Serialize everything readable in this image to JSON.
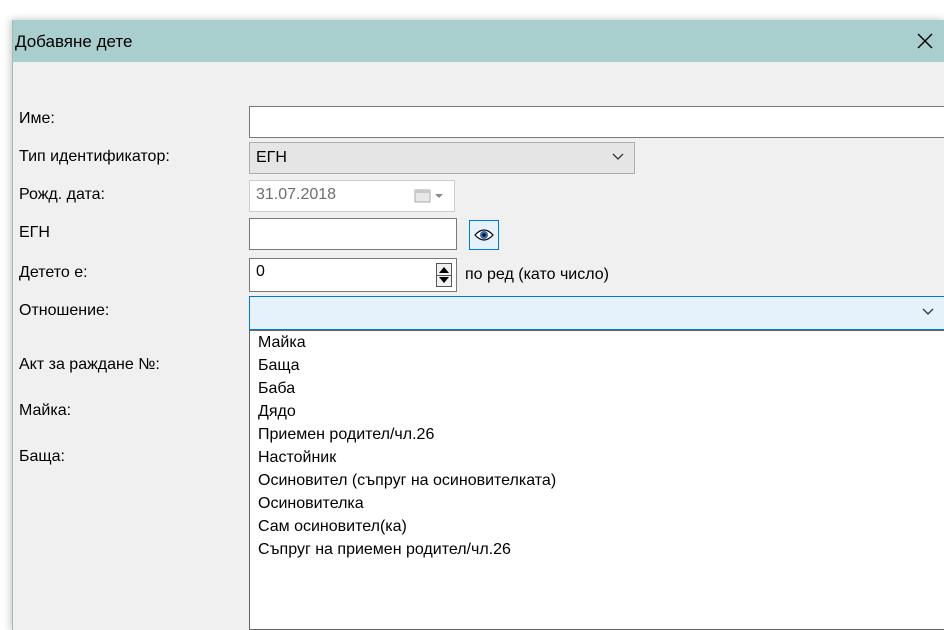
{
  "window": {
    "title": "Добавяне дете"
  },
  "form": {
    "name_label": "Име:",
    "name_value": "",
    "id_type_label": "Тип идентификатор:",
    "id_type_value": "ЕГН",
    "birth_date_label": "Рожд. дата:",
    "birth_date_value": "31.07.2018",
    "egn_label": "ЕГН",
    "egn_value": "",
    "child_order_label": "Детето е:",
    "child_order_value": "0",
    "child_order_suffix": "по ред (като число)",
    "relation_label": "Отношение:",
    "relation_value": "",
    "birth_act_label": "Акт за раждане №:",
    "mother_label": "Майка:",
    "father_label": "Баща:"
  },
  "relation_options": [
    "Майка",
    "Баща",
    "Баба",
    "Дядо",
    "Приемен родител/чл.26",
    "Настойник",
    "Осиновител (съпруг на осиновителката)",
    "Осиновителка",
    "Сам осиновител(ка)",
    "Съпруг на приемен родител/чл.26"
  ],
  "colors": {
    "titlebar": "#a9cece",
    "focus_border": "#0078d7",
    "focus_fill": "#e5f1fb"
  }
}
